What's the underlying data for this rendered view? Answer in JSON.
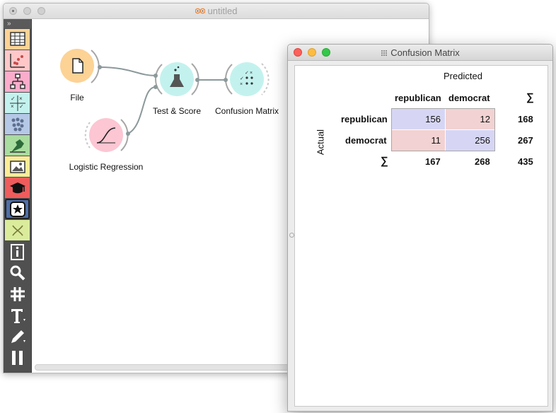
{
  "main_window": {
    "title": "untitled",
    "toolbox_expand": "»",
    "toolbox": [
      {
        "name": "data",
        "color": "#FDD295"
      },
      {
        "name": "visualize",
        "color": "#FFC7C8"
      },
      {
        "name": "model",
        "color": "#FCACCB"
      },
      {
        "name": "evaluate",
        "color": "#C3F2EE"
      },
      {
        "name": "unsupervised",
        "color": "#B5C8E6"
      },
      {
        "name": "prototypes",
        "color": "#A9DC9F"
      },
      {
        "name": "image-analytics",
        "color": "#FBEC97"
      },
      {
        "name": "educational",
        "color": "#EE5C5C"
      },
      {
        "name": "favorites",
        "color": "#4F6FA8"
      },
      {
        "name": "bioinformatics",
        "color": "#DAEC9C"
      },
      {
        "name": "info",
        "color": "#505050"
      },
      {
        "name": "zoom",
        "color": "#505050"
      },
      {
        "name": "grid",
        "color": "#505050"
      },
      {
        "name": "text",
        "color": "#505050"
      },
      {
        "name": "pen",
        "color": "#505050"
      },
      {
        "name": "pause",
        "color": "#505050"
      }
    ],
    "widgets": {
      "file": {
        "label": "File",
        "color": "#FDD295"
      },
      "logistic_regression": {
        "label": "Logistic Regression",
        "color": "#FCC6D3"
      },
      "test_score": {
        "label": "Test & Score",
        "color": "#C3F2EE"
      },
      "confusion_matrix": {
        "label": "Confusion Matrix",
        "color": "#C3F2EE"
      }
    }
  },
  "confusion_window": {
    "title": "Confusion Matrix",
    "predicted_label": "Predicted",
    "actual_label": "Actual",
    "col_headers": [
      "republican",
      "democrat"
    ],
    "sigma": "∑",
    "rows": [
      {
        "label": "republican",
        "values": [
          "156",
          "12"
        ],
        "total": "168"
      },
      {
        "label": "democrat",
        "values": [
          "11",
          "256"
        ],
        "total": "267"
      }
    ],
    "col_totals": [
      "167",
      "268"
    ],
    "grand_total": "435",
    "colors": {
      "correct": "#D6D6F4",
      "wrong": "#F2D2D2"
    }
  }
}
